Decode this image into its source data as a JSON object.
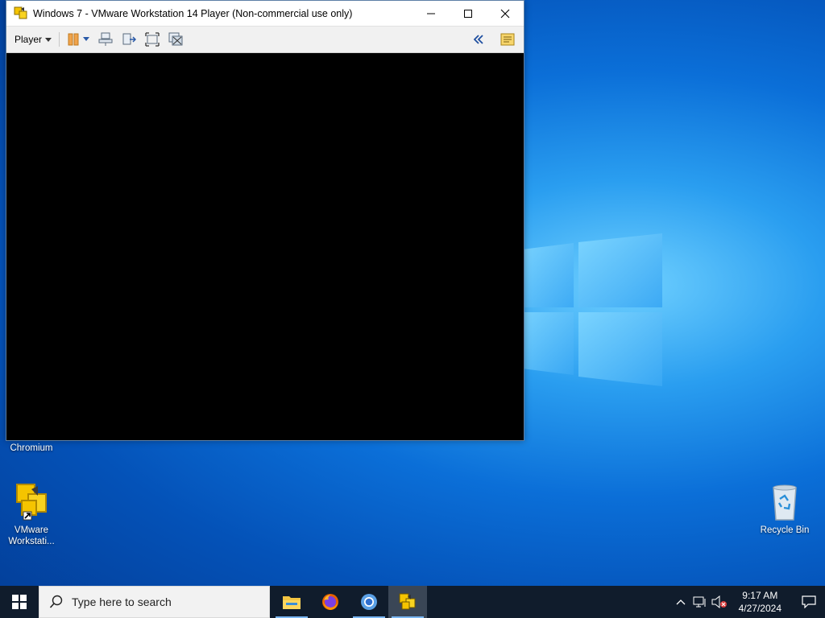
{
  "window": {
    "title": "Windows 7 - VMware Workstation 14 Player (Non-commercial use only)",
    "toolbar": {
      "player_menu": "Player"
    }
  },
  "desktop": {
    "icons": [
      {
        "label": "Chromium"
      },
      {
        "label": "VMware\nWorkstati..."
      },
      {
        "label": "Recycle Bin"
      }
    ]
  },
  "taskbar": {
    "search_placeholder": "Type here to search",
    "apps": [
      "file-explorer",
      "firefox",
      "chromium",
      "vmware-player"
    ],
    "clock": {
      "time": "9:17 AM",
      "date": "4/27/2024"
    }
  },
  "colors": {
    "taskbar_bg": "#101c2c",
    "vm_screen": "#000000",
    "accent": "#0078d7"
  }
}
